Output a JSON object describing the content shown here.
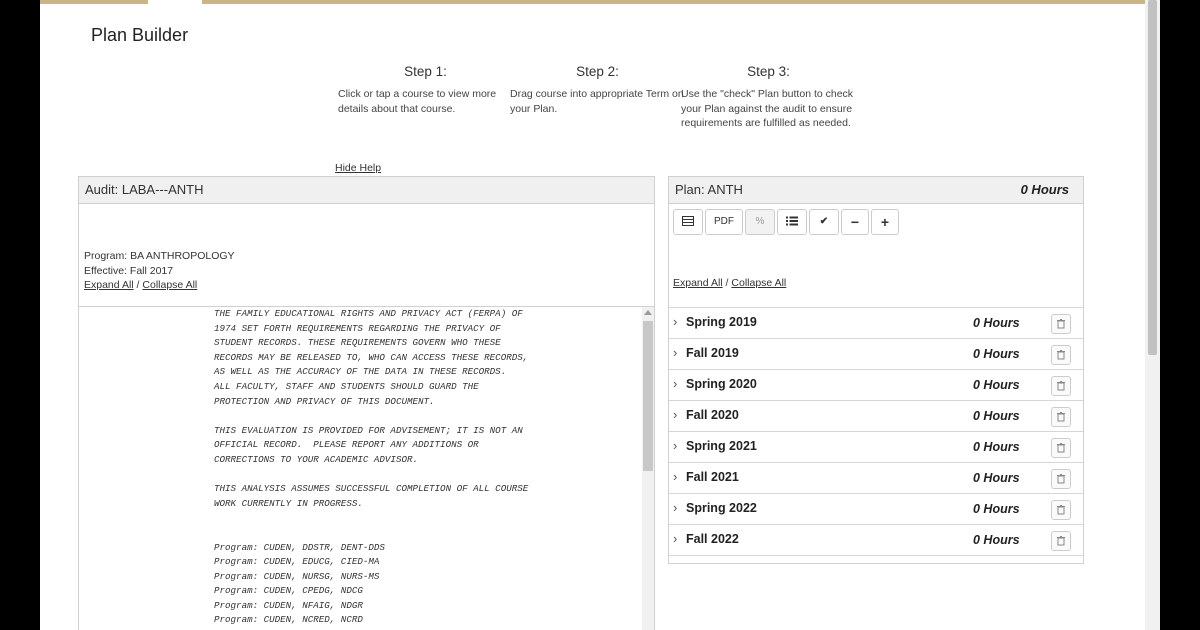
{
  "page": {
    "title": "Plan Builder"
  },
  "help": {
    "steps": [
      {
        "title": "Step 1:",
        "text": "Click or tap a course to view more details about that course."
      },
      {
        "title": "Step 2:",
        "text": "Drag course into appropriate Term on your Plan."
      },
      {
        "title": "Step 3:",
        "text": "Use the \"check\" Plan button to check your Plan against the audit to ensure requirements are fulfilled as needed."
      }
    ],
    "hide_label": "Hide Help"
  },
  "audit": {
    "title": "Audit: LABA---ANTH",
    "program": "Program: BA ANTHROPOLOGY",
    "effective": "Effective: Fall 2017",
    "expand_all": "Expand All",
    "separator": " / ",
    "collapse_all": "Collapse All",
    "text": "THE FAMILY EDUCATIONAL RIGHTS AND PRIVACY ACT (FERPA) OF\n1974 SET FORTH REQUIREMENTS REGARDING THE PRIVACY OF\nSTUDENT RECORDS. THESE REQUIREMENTS GOVERN WHO THESE\nRECORDS MAY BE RELEASED TO, WHO CAN ACCESS THESE RECORDS,\nAS WELL AS THE ACCURACY OF THE DATA IN THESE RECORDS.\nALL FACULTY, STAFF AND STUDENTS SHOULD GUARD THE\nPROTECTION AND PRIVACY OF THIS DOCUMENT.\n\nTHIS EVALUATION IS PROVIDED FOR ADVISEMENT; IT IS NOT AN\nOFFICIAL RECORD.  PLEASE REPORT ANY ADDITIONS OR\nCORRECTIONS TO YOUR ACADEMIC ADVISOR.\n\nTHIS ANALYSIS ASSUMES SUCCESSFUL COMPLETION OF ALL COURSE\nWORK CURRENTLY IN PROGRESS.\n\n\nProgram: CUDEN, DDSTR, DENT-DDS\nProgram: CUDEN, EDUCG, CIED-MA\nProgram: CUDEN, NURSG, NURS-MS\nProgram: CUDEN, CPEDG, NDCG\nProgram: CUDEN, NFAIG, NDGR\nProgram: CUDEN, NCRED, NCRD"
  },
  "plan": {
    "title": "Plan: ANTH",
    "hours": "0 Hours",
    "toolbar": {
      "table_icon": "table-icon",
      "pdf_label": "PDF",
      "link_icon": "link-icon",
      "list_icon": "list-icon",
      "check_icon": "checkmark-icon",
      "collapse_icon": "minus-icon",
      "expand_icon": "plus-icon"
    },
    "expand_all": "Expand All",
    "separator": " / ",
    "collapse_all": "Collapse All",
    "terms": [
      {
        "name": "Spring 2019",
        "hours": "0 Hours"
      },
      {
        "name": "Fall 2019",
        "hours": "0 Hours"
      },
      {
        "name": "Spring 2020",
        "hours": "0 Hours"
      },
      {
        "name": "Fall 2020",
        "hours": "0 Hours"
      },
      {
        "name": "Spring 2021",
        "hours": "0 Hours"
      },
      {
        "name": "Fall 2021",
        "hours": "0 Hours"
      },
      {
        "name": "Spring 2022",
        "hours": "0 Hours"
      },
      {
        "name": "Fall 2022",
        "hours": "0 Hours"
      }
    ]
  },
  "colors": {
    "accent_bar": "#c9b585",
    "panel_header": "#f0f0f0",
    "border": "#d0d0d0"
  }
}
